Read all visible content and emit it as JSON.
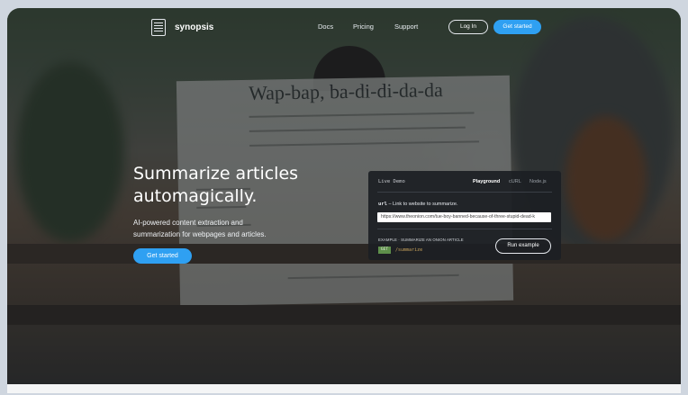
{
  "nav": {
    "brand": "synopsis",
    "links": [
      "Docs",
      "Pricing",
      "Support"
    ],
    "login": "Log In",
    "get_started": "Get started"
  },
  "hero": {
    "title_line1": "Summarize articles",
    "title_line2": "automagically.",
    "subtitle_line1": "AI-powered content extraction and",
    "subtitle_line2": "summarization for webpages and articles.",
    "cta": "Get started",
    "newspaper_headline": "Wap-bap, ba-di-di-da-da"
  },
  "demo": {
    "title": "Live Demo",
    "tabs": [
      {
        "label": "Playground",
        "active": true
      },
      {
        "label": "cURL",
        "active": false
      },
      {
        "label": "Node.js",
        "active": false
      }
    ],
    "param_name": "url",
    "param_desc": " – Link to website to summarize.",
    "url_value": "https://www.theonion.com/tue-boy-banned-because-of-three-stupid-dead-k",
    "example_label": "EXAMPLE · SUMMARIZE AN ONION ARTICLE",
    "method": "GET",
    "endpoint": "/summarize",
    "run_button": "Run example"
  },
  "colors": {
    "accent": "#2fa0f2",
    "demo_bg": "#1c1f24",
    "get_badge": "#5e8f4b"
  },
  "icons": {
    "logo": "document-columns-icon"
  }
}
